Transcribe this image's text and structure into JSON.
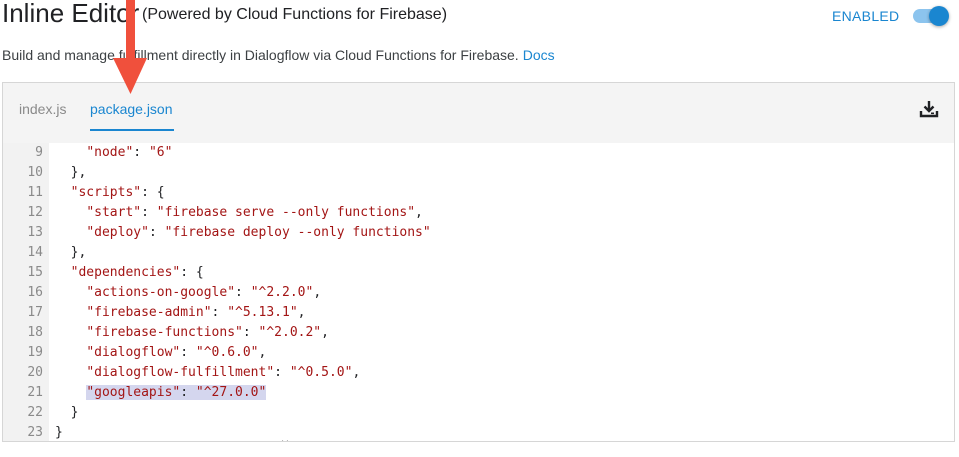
{
  "header": {
    "title": "Inline Editor",
    "subtitle": "(Powered by Cloud Functions for Firebase)",
    "status_label": "ENABLED",
    "toggle_on": true
  },
  "description": {
    "text": "Build and manage fulfillment directly in Dialogflow via Cloud Functions for Firebase.",
    "link_text": "Docs"
  },
  "tabs": [
    {
      "label": "index.js",
      "active": false
    },
    {
      "label": "package.json",
      "active": true
    }
  ],
  "icons": {
    "download": "download-icon",
    "annotation_arrow": "red-arrow-down-icon",
    "text_cursor": "text-cursor-icon"
  },
  "colors": {
    "accent": "#1a86d0",
    "string": "#a31515",
    "selection": "#d4d6ee",
    "arrow": "#f0503c"
  },
  "code_lines": [
    {
      "num": "9",
      "indent": "    ",
      "key": "\"node\"",
      "sep": ": ",
      "val": "\"6\"",
      "tail": ""
    },
    {
      "num": "10",
      "indent": "  ",
      "plain": "},"
    },
    {
      "num": "11",
      "indent": "  ",
      "key": "\"scripts\"",
      "sep": ": {",
      "val": "",
      "tail": ""
    },
    {
      "num": "12",
      "indent": "    ",
      "key": "\"start\"",
      "sep": ": ",
      "val": "\"firebase serve --only functions\"",
      "tail": ","
    },
    {
      "num": "13",
      "indent": "    ",
      "key": "\"deploy\"",
      "sep": ": ",
      "val": "\"firebase deploy --only functions\"",
      "tail": ""
    },
    {
      "num": "14",
      "indent": "  ",
      "plain": "},"
    },
    {
      "num": "15",
      "indent": "  ",
      "key": "\"dependencies\"",
      "sep": ": {",
      "val": "",
      "tail": ""
    },
    {
      "num": "16",
      "indent": "    ",
      "key": "\"actions-on-google\"",
      "sep": ": ",
      "val": "\"^2.2.0\"",
      "tail": ","
    },
    {
      "num": "17",
      "indent": "    ",
      "key": "\"firebase-admin\"",
      "sep": ": ",
      "val": "\"^5.13.1\"",
      "tail": ","
    },
    {
      "num": "18",
      "indent": "    ",
      "key": "\"firebase-functions\"",
      "sep": ": ",
      "val": "\"^2.0.2\"",
      "tail": ","
    },
    {
      "num": "19",
      "indent": "    ",
      "key": "\"dialogflow\"",
      "sep": ": ",
      "val": "\"^0.6.0\"",
      "tail": ","
    },
    {
      "num": "20",
      "indent": "    ",
      "key": "\"dialogflow-fulfillment\"",
      "sep": ": ",
      "val": "\"^0.5.0\"",
      "tail": ","
    },
    {
      "num": "21",
      "indent": "    ",
      "key": "\"googleapis\"",
      "sep": ": ",
      "val": "\"^27.0.0\"",
      "tail": "",
      "selected": true
    },
    {
      "num": "22",
      "indent": "  ",
      "plain": "}"
    },
    {
      "num": "23",
      "indent": "",
      "plain": "}"
    }
  ]
}
